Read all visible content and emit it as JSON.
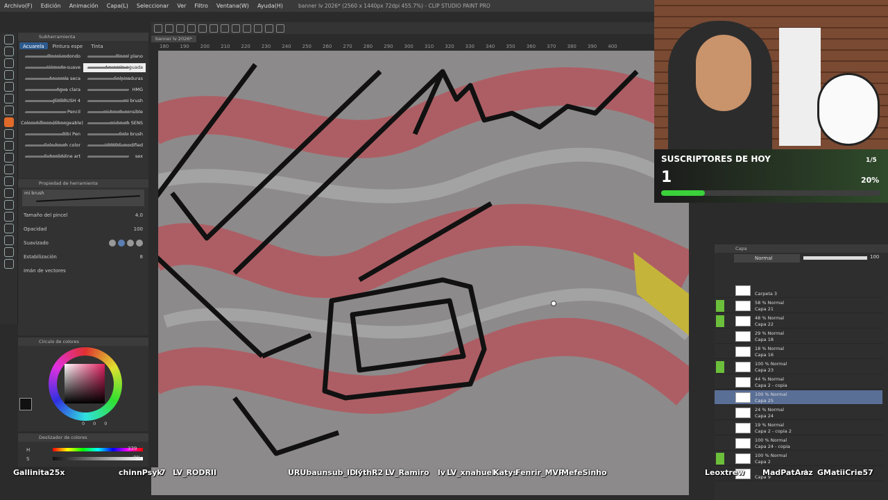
{
  "menu": [
    "Archivo(F)",
    "Edición",
    "Animación",
    "Capa(L)",
    "Seleccionar",
    "Ver",
    "Filtro",
    "Ventana(W)",
    "Ayuda(H)"
  ],
  "window_title": "banner lv 2026* (2560 x 1440px 72dpi 455.7%) - CLIP STUDIO PAINT PRO",
  "doc_tab": "banner lv 2026*",
  "ruler_labels": [
    "180",
    "190",
    "200",
    "210",
    "220",
    "230",
    "240",
    "250",
    "260",
    "270",
    "280",
    "290",
    "300",
    "310",
    "320",
    "330",
    "340",
    "350",
    "360",
    "370",
    "380",
    "390",
    "400"
  ],
  "subtool": {
    "header": "Subherramienta",
    "tabs": [
      "Acuarela",
      "Pintura espe",
      "Tinta"
    ],
    "brushes": [
      {
        "left": "Pincel redondo",
        "right": "Pincel plano"
      },
      {
        "left": "Húmedo suave",
        "right": "Acuarela aguada"
      },
      {
        "left": "Acuarela seca",
        "right": "Salpicaduras"
      },
      {
        "left": "Agua clara",
        "right": "HMG"
      },
      {
        "left": "JEKBRUSH 4",
        "right": "mi brush"
      },
      {
        "left": "Pencil",
        "right": "mi brush sensible"
      },
      {
        "left": "Colored Trees (Changeable)",
        "right": "mi brush SENS"
      },
      {
        "left": "Bibi Pen",
        "right": "Colo brush"
      },
      {
        "left": "Colo brush color",
        "right": "HMKOG modified"
      },
      {
        "left": "Subsolid line art",
        "right": "sex"
      }
    ]
  },
  "toolprop": {
    "header": "Propiedad de herramienta",
    "brush_name": "mi brush",
    "size_label": "Tamaño del pincel",
    "size_value": "4.0",
    "opacity_label": "Opacidad",
    "opacity_value": "100",
    "smoothing_label": "Suavizado",
    "stabilization_label": "Estabilización",
    "stabilization_value": "8",
    "vector_label": "Imán de vectores"
  },
  "color_circle": {
    "header": "Círculo de colores",
    "values": [
      "0",
      "0",
      "0"
    ]
  },
  "color_sliders": {
    "header": "Deslizador de colores",
    "h_label": "H",
    "h_value": "339",
    "s_label": "S",
    "s_value": "0%"
  },
  "subs": {
    "title": "SUSCRIPTORES DE HOY",
    "count": "1",
    "goal": "1/5",
    "percent": "20%",
    "progress": 0.2
  },
  "layer_panel": {
    "header": "Capa",
    "blend_mode": "Normal",
    "opacity": "100",
    "layers": [
      {
        "mode": "",
        "name": "Carpeta 3",
        "visible": false,
        "selected": false
      },
      {
        "mode": "58 % Normal",
        "name": "Capa 21",
        "visible": true,
        "selected": false
      },
      {
        "mode": "48 % Normal",
        "name": "Capa 22",
        "visible": true,
        "selected": false
      },
      {
        "mode": "29 % Normal",
        "name": "Capa 18",
        "visible": false,
        "selected": false
      },
      {
        "mode": "18 % Normal",
        "name": "Capa 16",
        "visible": false,
        "selected": false
      },
      {
        "mode": "100 % Normal",
        "name": "Capa 23",
        "visible": true,
        "selected": false
      },
      {
        "mode": "44 % Normal",
        "name": "Capa 2 - copia",
        "visible": false,
        "selected": false
      },
      {
        "mode": "100 % Normal",
        "name": "Capa 25",
        "visible": false,
        "selected": true
      },
      {
        "mode": "24 % Normal",
        "name": "Capa 24",
        "visible": false,
        "selected": false
      },
      {
        "mode": "19 % Normal",
        "name": "Capa 2 - copia 2",
        "visible": false,
        "selected": false
      },
      {
        "mode": "100 % Normal",
        "name": "Capa 24 - copia",
        "visible": false,
        "selected": false
      },
      {
        "mode": "100 % Normal",
        "name": "Capa 2",
        "visible": true,
        "selected": false
      },
      {
        "mode": "",
        "name": "Capa 9",
        "visible": false,
        "selected": false
      }
    ]
  },
  "chat_names": [
    "Gallinita25x",
    "chinnPsyk",
    "7",
    "LV_RODRII",
    "URUbaunsub_IDK",
    "lythR2",
    "LV_Ramiro",
    "lv",
    "LV_xnahuel",
    "Katys",
    "Fenrir_MVP",
    "MefeSinho",
    "Leoxtrew",
    "MadPatArt",
    "az",
    "GMatiiCris",
    "e57"
  ],
  "colors": {
    "accent": "#2d5a8e",
    "active_tool": "#e06a2a",
    "progress": "#3bd13b",
    "layer_visible": "#6bbf3a"
  }
}
